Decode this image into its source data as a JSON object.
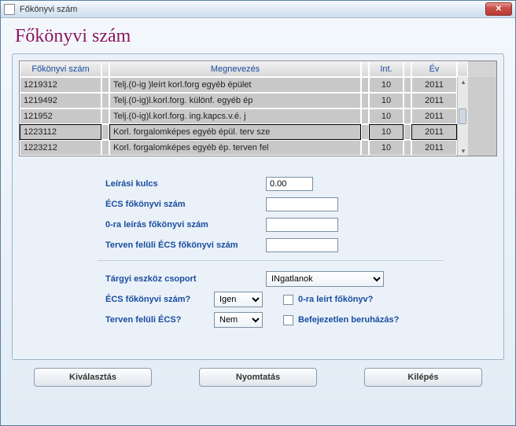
{
  "window": {
    "title": "Főkönyvi szám",
    "close_label": "✕"
  },
  "heading": "Főkönyvi szám",
  "grid": {
    "headers": {
      "fokonyvi": "Főkönyvi szám",
      "megnevezes": "Megnevezés",
      "int": "Int.",
      "ev": "Év"
    },
    "rows": [
      {
        "fk": "1219312",
        "meg": "Telj.(0-ig )leírt korl.forg egyéb épület",
        "int": "10",
        "ev": "2011",
        "selected": false
      },
      {
        "fk": "1219492",
        "meg": "Telj.(0-ig)l.korl.forg. különf. egyéb ép",
        "int": "10",
        "ev": "2011",
        "selected": false
      },
      {
        "fk": "121952",
        "meg": "Telj.(0-ig)l.korl.forg. ing.kapcs.v.é. j",
        "int": "10",
        "ev": "2011",
        "selected": false
      },
      {
        "fk": "1223112",
        "meg": "Korl. forgalomképes egyéb épül. terv sze",
        "int": "10",
        "ev": "2011",
        "selected": true
      },
      {
        "fk": "1223212",
        "meg": "Korl. forgalomképes egyéb ép. terven fel",
        "int": "10",
        "ev": "2011",
        "selected": false
      }
    ]
  },
  "form": {
    "leirasi_kulcs_label": "Leírási kulcs",
    "leirasi_kulcs_value": "0.00",
    "ecs_fk_label": "ÉCS főkönyvi szám",
    "ecs_fk_value": "",
    "nullra_label": "0-ra leírás főkönyvi szám",
    "nullra_value": "",
    "terven_feluli_fk_label": "Terven felüli ÉCS főkönyvi szám",
    "terven_feluli_fk_value": "",
    "targyi_label": "Tárgyi eszköz csoport",
    "targyi_value": "INgatlanok",
    "ecs_fk_q_label": "ÉCS főkönyvi szám?",
    "ecs_fk_q_value": "Igen",
    "nullra_q_label": "0-ra leírt főkönyv?",
    "terven_feluli_q_label": "Terven felüli ÉCS?",
    "terven_feluli_q_value": "Nem",
    "befejezetlen_label": "Befejezetlen beruházás?"
  },
  "buttons": {
    "select": "Kiválasztás",
    "print": "Nyomtatás",
    "exit": "Kilépés"
  }
}
